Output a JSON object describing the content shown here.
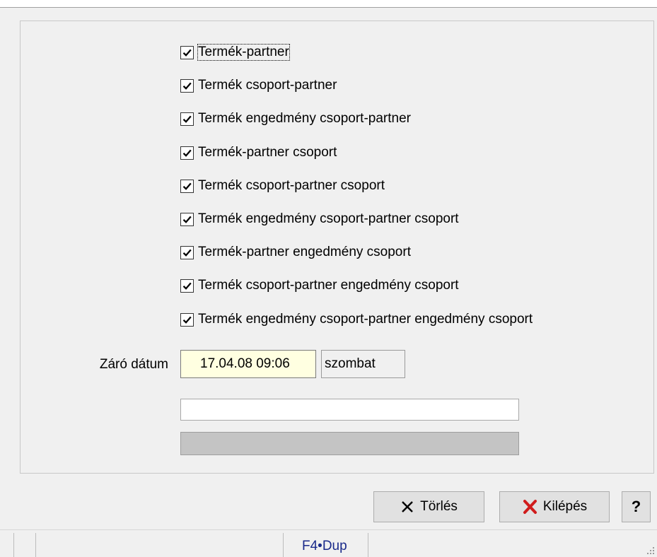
{
  "checkboxes": [
    {
      "label": "Termék-partner",
      "checked": true
    },
    {
      "label": "Termék csoport-partner",
      "checked": true
    },
    {
      "label": "Termék engedmény csoport-partner",
      "checked": true
    },
    {
      "label": "Termék-partner csoport",
      "checked": true
    },
    {
      "label": "Termék csoport-partner csoport",
      "checked": true
    },
    {
      "label": "Termék engedmény csoport-partner csoport",
      "checked": true
    },
    {
      "label": "Termék-partner engedmény csoport",
      "checked": true
    },
    {
      "label": "Termék csoport-partner engedmény csoport",
      "checked": true
    },
    {
      "label": "Termék engedmény csoport-partner engedmény csoport",
      "checked": true
    }
  ],
  "date": {
    "label": "Záró dátum",
    "value": "17.04.08 09:06",
    "day": "szombat"
  },
  "buttons": {
    "delete_label": "Törlés",
    "exit_label": "Kilépés",
    "help_label": "?"
  },
  "statusbar": {
    "text": "F4•Dup"
  },
  "colors": {
    "date_bg": "#ffffe1",
    "exit_icon": "#d01c1c",
    "status_text": "#1a2a8a"
  }
}
